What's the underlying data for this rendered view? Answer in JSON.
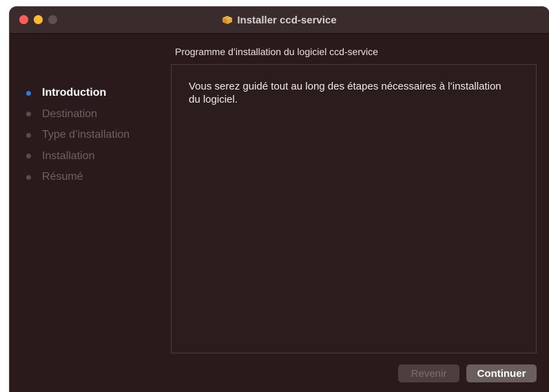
{
  "window": {
    "title": "Installer ccd-service",
    "icon": "package-icon"
  },
  "header": {
    "subtitle": "Programme d’installation du logiciel ccd-service"
  },
  "sidebar": {
    "steps": [
      {
        "label": "Introduction",
        "active": true
      },
      {
        "label": "Destination",
        "active": false
      },
      {
        "label": "Type d’installation",
        "active": false
      },
      {
        "label": "Installation",
        "active": false
      },
      {
        "label": "Résumé",
        "active": false
      }
    ]
  },
  "content": {
    "text": "Vous serez guidé tout au long des étapes nécessaires à l’installation du logiciel."
  },
  "buttons": {
    "back_label": "Revenir",
    "continue_label": "Continuer"
  },
  "colors": {
    "accent": "#2f7ae5",
    "close": "#ff5f57",
    "minimize": "#febc2e",
    "background": "#2a1a1b"
  }
}
